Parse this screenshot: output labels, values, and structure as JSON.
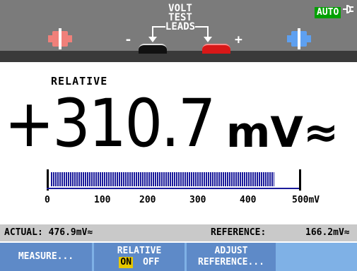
{
  "header": {
    "leads_label_lines": [
      "VOLT",
      "TEST",
      "LEADS"
    ],
    "minus_sign": "-",
    "plus_sign": "+",
    "mode_badge": "AUTO",
    "colors": {
      "red_jack": "#f0807a",
      "blue_jack": "#5ea0f0",
      "auto_badge": "#00a000",
      "header_bg": "#7b7b7b"
    },
    "icons": [
      "left-arrow-icon",
      "right-arrow-icon",
      "plug-icon"
    ]
  },
  "main": {
    "mode_label": "RELATIVE",
    "reading_value": "+310.7",
    "reading_unit": "mV≈"
  },
  "bargraph": {
    "tick_labels": [
      "0",
      "100",
      "200",
      "300",
      "400",
      "500mV"
    ],
    "max_value": 500,
    "fill_value": 465,
    "color": "#1a1a9a"
  },
  "status": {
    "actual_label": "ACTUAL: 476.9mV≈",
    "reference_label": "REFERENCE:",
    "reference_value": "166.2mV≈"
  },
  "softkeys": {
    "measure": "MEASURE...",
    "relative_title": "RELATIVE",
    "relative_on": "ON",
    "relative_off": "OFF",
    "adjust_line1": "ADJUST",
    "adjust_line2": "REFERENCE...",
    "colors": {
      "key_bg": "#5e8ac8",
      "bar_bg": "#7fb1e6",
      "on_highlight": "#e8c800"
    }
  }
}
